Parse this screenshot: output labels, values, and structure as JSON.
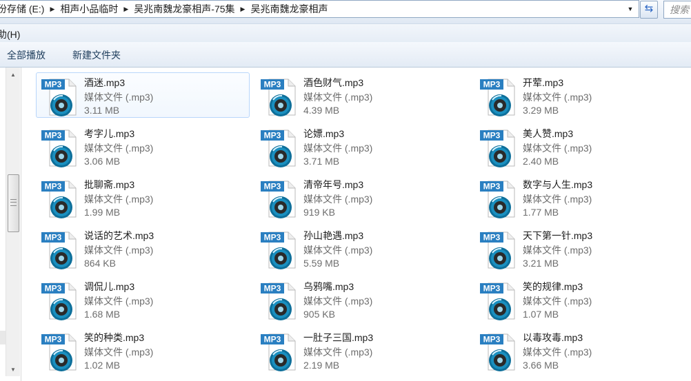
{
  "address_bar": {
    "breadcrumbs": [
      "份存储 (E:)",
      "相声小品临时",
      "吴兆南魏龙豪相声-75集",
      "吴兆南魏龙豪相声"
    ],
    "search_placeholder": "搜索"
  },
  "menu": {
    "help_label": "助(H)"
  },
  "toolbar": {
    "play_all_label": "全部播放",
    "new_folder_label": "新建文件夹"
  },
  "nav_pane": {
    "edge_glyph": "≡"
  },
  "files": [
    {
      "name": "酒迷.mp3",
      "type": "媒体文件 (.mp3)",
      "size": "3.11 MB",
      "selected": true
    },
    {
      "name": "酒色财气.mp3",
      "type": "媒体文件 (.mp3)",
      "size": "4.39 MB"
    },
    {
      "name": "开荤.mp3",
      "type": "媒体文件 (.mp3)",
      "size": "3.29 MB"
    },
    {
      "name": "考字儿.mp3",
      "type": "媒体文件 (.mp3)",
      "size": "3.06 MB"
    },
    {
      "name": "论嫖.mp3",
      "type": "媒体文件 (.mp3)",
      "size": "3.71 MB"
    },
    {
      "name": "美人赞.mp3",
      "type": "媒体文件 (.mp3)",
      "size": "2.40 MB"
    },
    {
      "name": "批聊斋.mp3",
      "type": "媒体文件 (.mp3)",
      "size": "1.99 MB"
    },
    {
      "name": "清帝年号.mp3",
      "type": "媒体文件 (.mp3)",
      "size": "919 KB"
    },
    {
      "name": "数字与人生.mp3",
      "type": "媒体文件 (.mp3)",
      "size": "1.77 MB"
    },
    {
      "name": "说话的艺术.mp3",
      "type": "媒体文件 (.mp3)",
      "size": "864 KB"
    },
    {
      "name": "孙山艳遇.mp3",
      "type": "媒体文件 (.mp3)",
      "size": "5.59 MB"
    },
    {
      "name": "天下第一针.mp3",
      "type": "媒体文件 (.mp3)",
      "size": "3.21 MB"
    },
    {
      "name": "调侃儿.mp3",
      "type": "媒体文件 (.mp3)",
      "size": "1.68 MB"
    },
    {
      "name": "乌鸦嘴.mp3",
      "type": "媒体文件 (.mp3)",
      "size": "905 KB"
    },
    {
      "name": "笑的规律.mp3",
      "type": "媒体文件 (.mp3)",
      "size": "1.07 MB"
    },
    {
      "name": "笑的种类.mp3",
      "type": "媒体文件 (.mp3)",
      "size": "1.02 MB"
    },
    {
      "name": "一肚子三国.mp3",
      "type": "媒体文件 (.mp3)",
      "size": "2.19 MB"
    },
    {
      "name": "以毒攻毒.mp3",
      "type": "媒体文件 (.mp3)",
      "size": "3.66 MB"
    }
  ],
  "icon": {
    "badge_text": "MP3",
    "name": "mp3-file-icon",
    "badge_color": "#2a7fc1",
    "disc_color": "#1a8fbf"
  }
}
